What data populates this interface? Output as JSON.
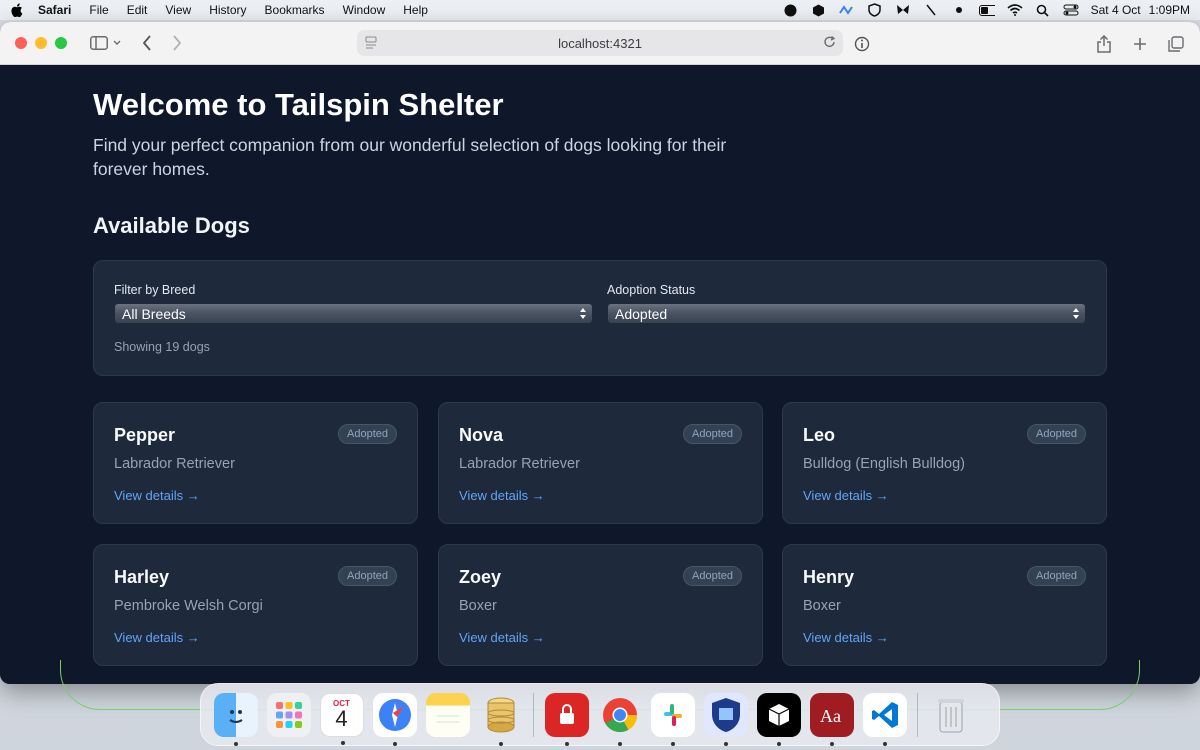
{
  "menubar": {
    "app_name": "Safari",
    "items": [
      "File",
      "Edit",
      "View",
      "History",
      "Bookmarks",
      "Window",
      "Help"
    ],
    "date": "Sat 4 Oct",
    "time": "1:09PM"
  },
  "browser": {
    "url": "localhost:4321"
  },
  "hero": {
    "title": "Welcome to Tailspin Shelter",
    "subtitle": "Find your perfect companion from our wonderful selection of dogs looking for their forever homes."
  },
  "section_title": "Available Dogs",
  "filters": {
    "breed_label": "Filter by Breed",
    "breed_value": "All Breeds",
    "status_label": "Adoption Status",
    "status_value": "Adopted",
    "showing_text": "Showing 19 dogs"
  },
  "dogs": [
    {
      "name": "Pepper",
      "breed": "Labrador Retriever",
      "status": "Adopted",
      "link": "View details →"
    },
    {
      "name": "Nova",
      "breed": "Labrador Retriever",
      "status": "Adopted",
      "link": "View details →"
    },
    {
      "name": "Leo",
      "breed": "Bulldog (English Bulldog)",
      "status": "Adopted",
      "link": "View details →"
    },
    {
      "name": "Harley",
      "breed": "Pembroke Welsh Corgi",
      "status": "Adopted",
      "link": "View details →"
    },
    {
      "name": "Zoey",
      "breed": "Boxer",
      "status": "Adopted",
      "link": "View details →"
    },
    {
      "name": "Henry",
      "breed": "Boxer",
      "status": "Adopted",
      "link": "View details →"
    }
  ],
  "dock": {
    "calendar_month": "OCT",
    "calendar_day": "4",
    "apps": [
      "finder-icon",
      "launchpad-icon",
      "calendar-icon",
      "safari-icon",
      "notes-icon",
      "database-icon",
      "password-app-icon",
      "chrome-icon",
      "slack-icon",
      "vpn-shield-icon",
      "cube-app-icon",
      "dictionary-icon",
      "vscode-icon",
      "trash-icon"
    ]
  },
  "colors": {
    "page_bg": "#0f172a",
    "card_bg": "#1e293b",
    "link": "#60a5fa"
  }
}
